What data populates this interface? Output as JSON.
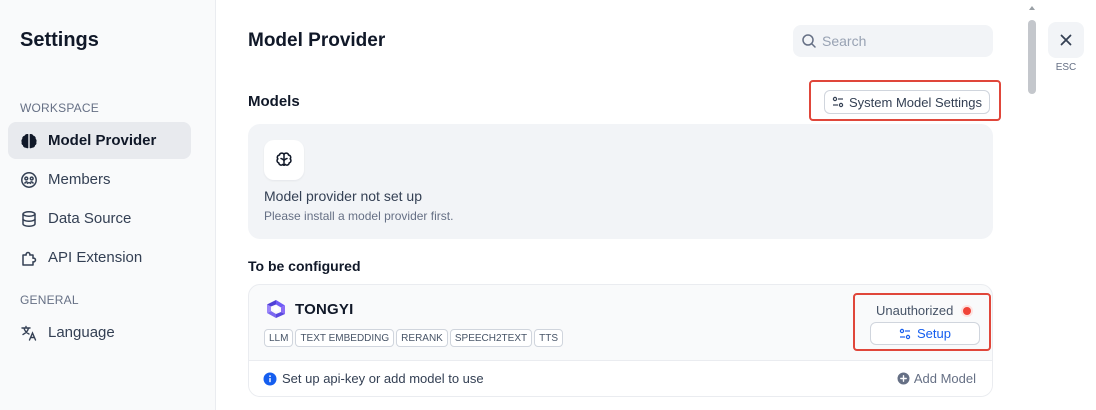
{
  "sidebar": {
    "title": "Settings",
    "workspace_label": "WORKSPACE",
    "general_label": "GENERAL",
    "items": [
      {
        "label": "Model Provider",
        "icon": "brain-icon",
        "active": true
      },
      {
        "label": "Members",
        "icon": "members-icon"
      },
      {
        "label": "Data Source",
        "icon": "database-icon"
      },
      {
        "label": "API Extension",
        "icon": "puzzle-icon"
      }
    ],
    "general_items": [
      {
        "label": "Language",
        "icon": "translate-icon"
      }
    ]
  },
  "main": {
    "title": "Model Provider",
    "search": {
      "placeholder": "Search",
      "value": ""
    },
    "models_heading": "Models",
    "system_model_settings_label": "System Model Settings",
    "empty_state": {
      "title": "Model provider not set up",
      "subtitle": "Please install a model provider first."
    },
    "to_be_configured_heading": "To be configured",
    "provider": {
      "name": "TONGYI",
      "tags": [
        "LLM",
        "TEXT EMBEDDING",
        "RERANK",
        "SPEECH2TEXT",
        "TTS"
      ],
      "status": "Unauthorized",
      "status_color": "#f04438",
      "setup_label": "Setup",
      "info_text": "Set up api-key or add model to use",
      "add_model_label": "Add Model"
    }
  },
  "close": {
    "esc_label": "ESC"
  },
  "colors": {
    "accent": "#155eef",
    "highlight_border": "#e0463a"
  }
}
